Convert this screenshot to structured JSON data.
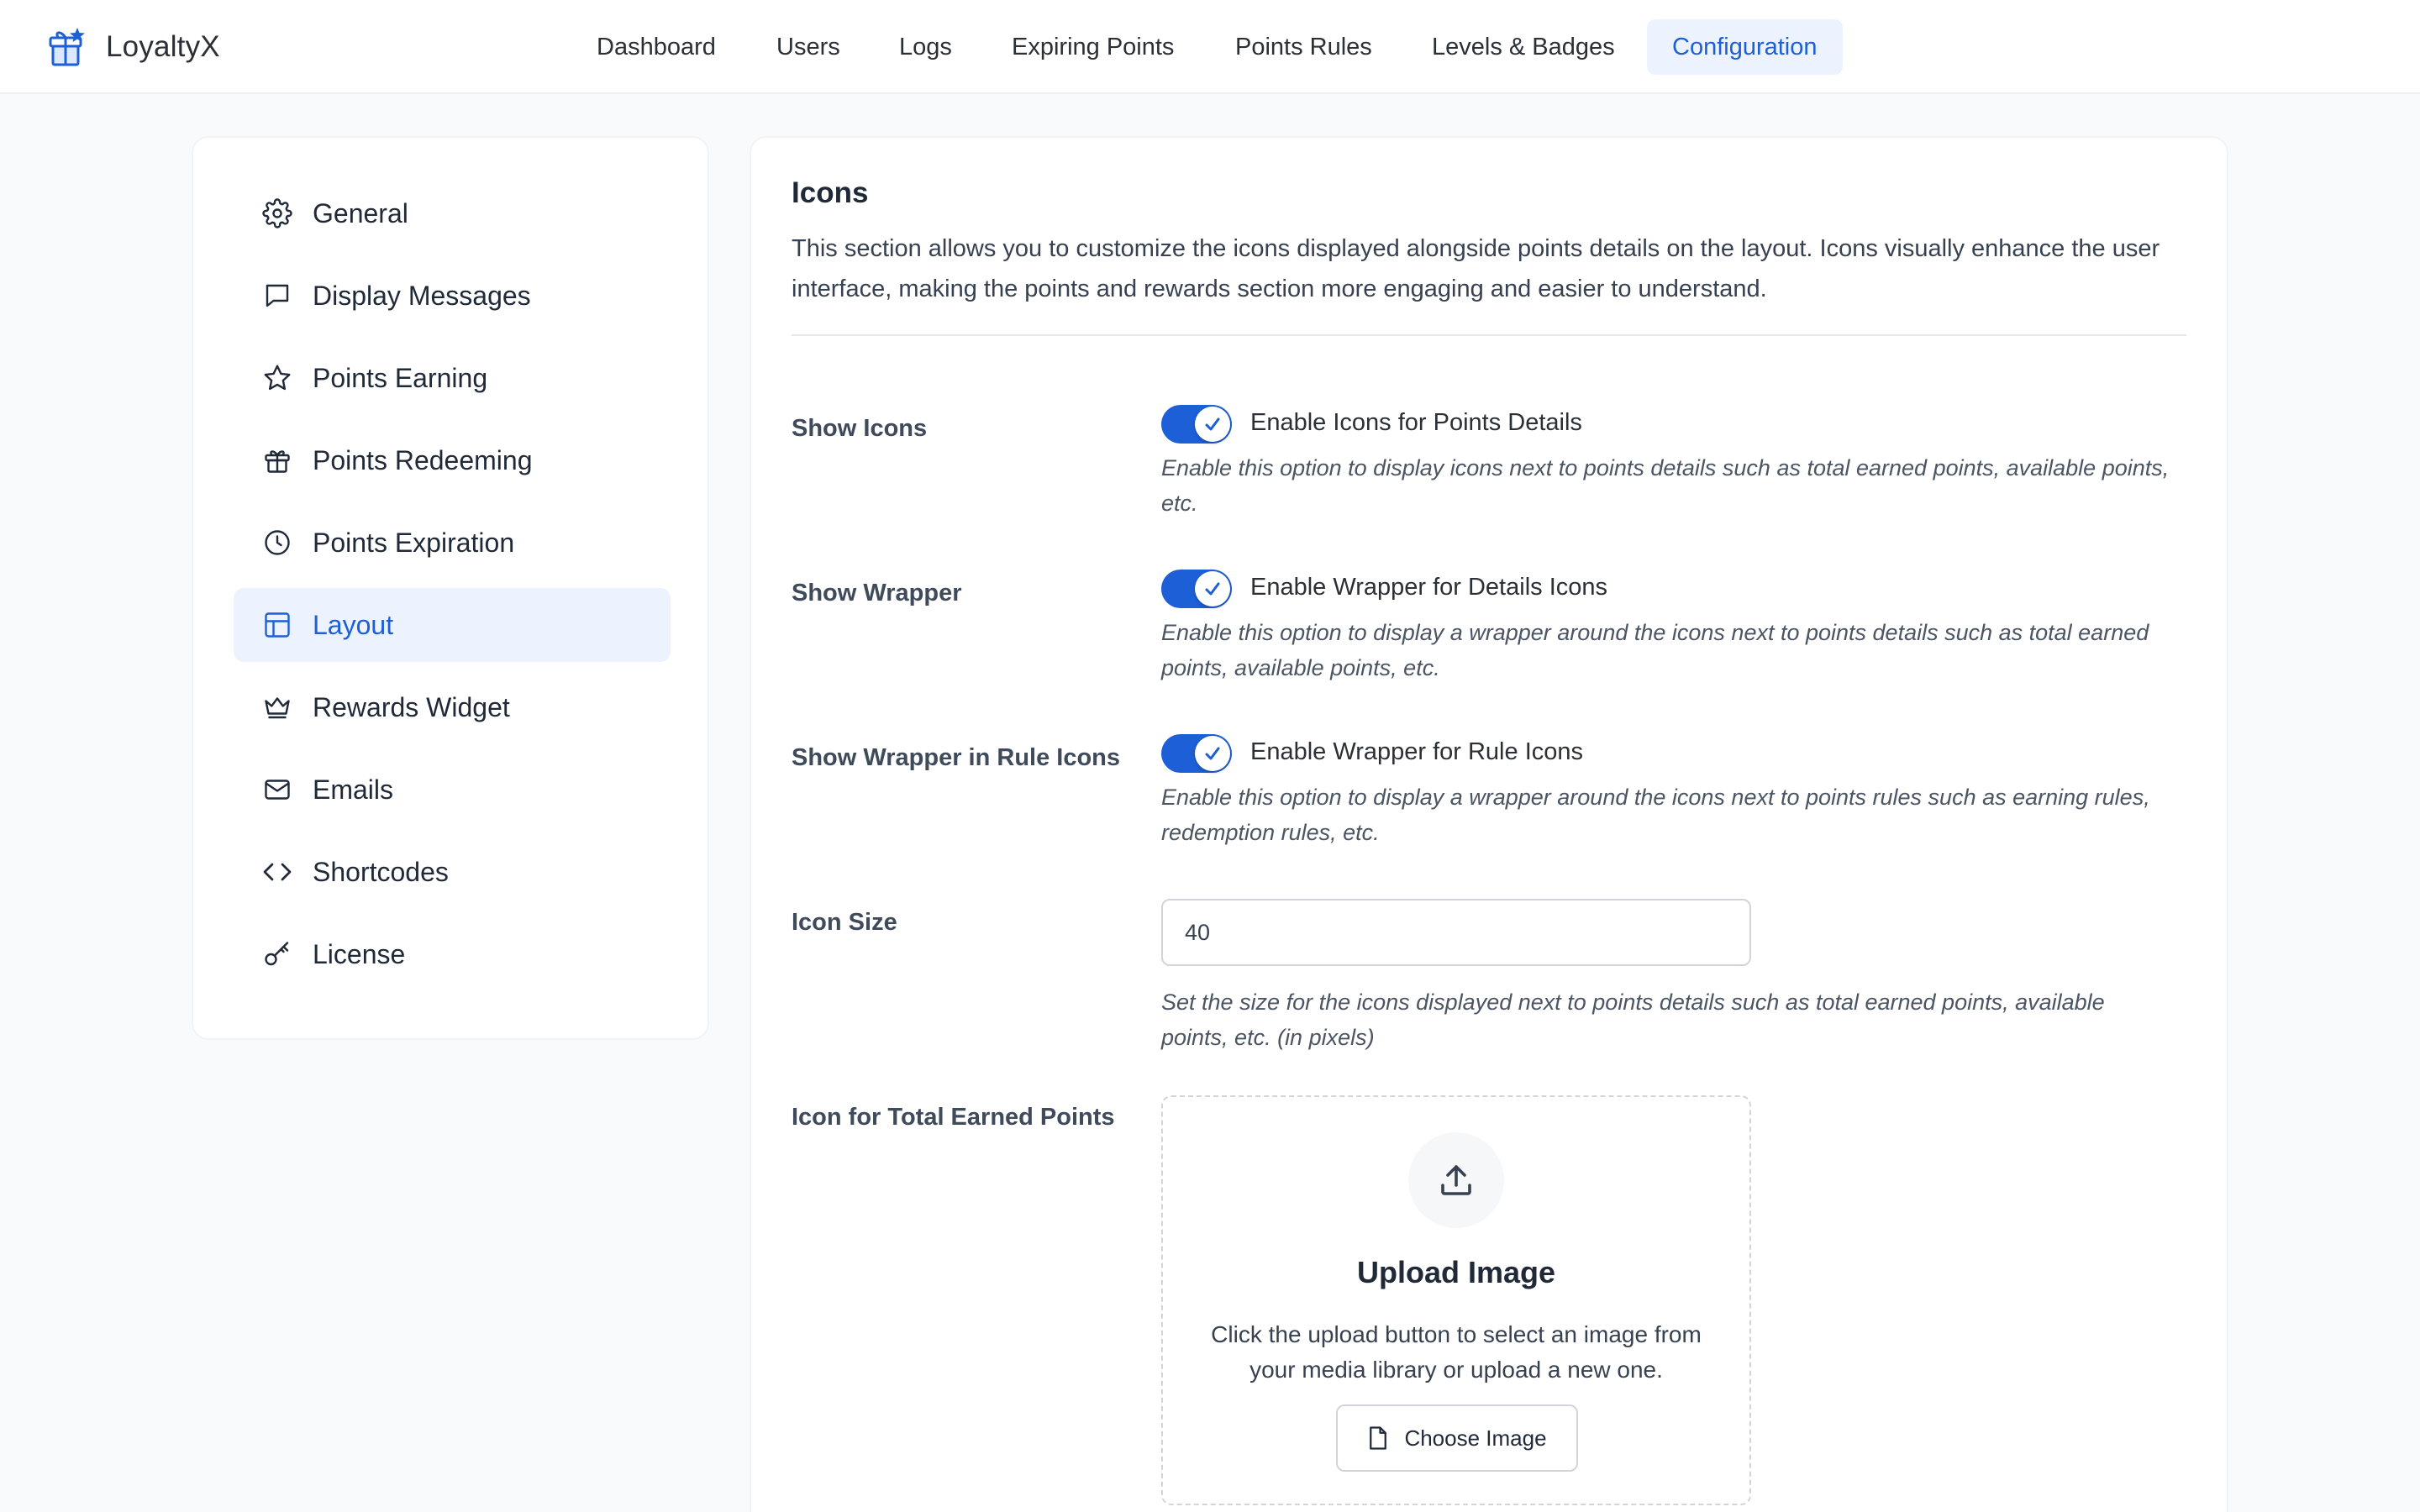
{
  "app": {
    "name": "LoyaltyX",
    "accent_color": "#1d5fd6",
    "logo_icon": "gift-icon"
  },
  "nav": {
    "items": [
      {
        "label": "Dashboard",
        "active": false
      },
      {
        "label": "Users",
        "active": false
      },
      {
        "label": "Logs",
        "active": false
      },
      {
        "label": "Expiring Points",
        "active": false
      },
      {
        "label": "Points Rules",
        "active": false
      },
      {
        "label": "Levels & Badges",
        "active": false
      },
      {
        "label": "Configuration",
        "active": true
      }
    ]
  },
  "sidebar": {
    "items": [
      {
        "label": "General",
        "icon": "gear-icon",
        "active": false
      },
      {
        "label": "Display Messages",
        "icon": "message-icon",
        "active": false
      },
      {
        "label": "Points Earning",
        "icon": "star-icon",
        "active": false
      },
      {
        "label": "Points Redeeming",
        "icon": "gift-icon",
        "active": false
      },
      {
        "label": "Points Expiration",
        "icon": "clock-icon",
        "active": false
      },
      {
        "label": "Layout",
        "icon": "layout-icon",
        "active": true
      },
      {
        "label": "Rewards Widget",
        "icon": "crown-icon",
        "active": false
      },
      {
        "label": "Emails",
        "icon": "mail-icon",
        "active": false
      },
      {
        "label": "Shortcodes",
        "icon": "code-icon",
        "active": false
      },
      {
        "label": "License",
        "icon": "key-icon",
        "active": false
      }
    ]
  },
  "section": {
    "title": "Icons",
    "description": "This section allows you to customize the icons displayed alongside points details on the layout. Icons visually enhance the user interface, making the points and rewards section more engaging and easier to understand."
  },
  "settings": {
    "show_icons": {
      "label": "Show Icons",
      "toggle_label": "Enable Icons for Points Details",
      "enabled": true,
      "help": "Enable this option to display icons next to points details such as total earned points, available points, etc."
    },
    "show_wrapper": {
      "label": "Show Wrapper",
      "toggle_label": "Enable Wrapper for Details Icons",
      "enabled": true,
      "help": "Enable this option to display a wrapper around the icons next to points details such as total earned points, available points, etc."
    },
    "show_wrapper_rule": {
      "label": "Show Wrapper in Rule Icons",
      "toggle_label": "Enable Wrapper for Rule Icons",
      "enabled": true,
      "help": "Enable this option to display a wrapper around the icons next to points rules such as earning rules, redemption rules, etc."
    },
    "icon_size": {
      "label": "Icon Size",
      "value": "40",
      "help": "Set the size for the icons displayed next to points details such as total earned points, available points, etc. (in pixels)"
    },
    "icon_total_earned": {
      "label": "Icon for Total Earned Points",
      "upload_title": "Upload Image",
      "upload_desc": "Click the upload button to select an image from your media library or upload a new one.",
      "button_label": "Choose Image"
    }
  }
}
